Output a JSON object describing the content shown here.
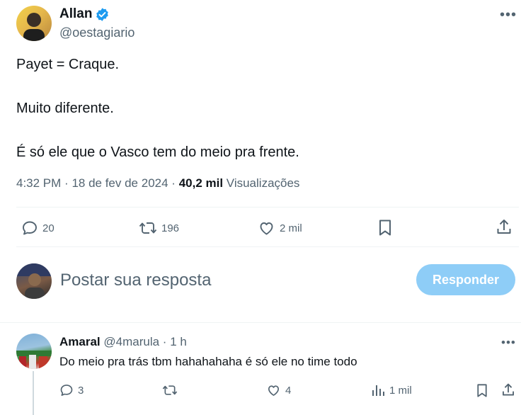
{
  "tweet": {
    "author_name": "Allan",
    "author_handle": "@oestagiario",
    "lines": [
      "Payet = Craque.",
      "Muito diferente.",
      "É só ele que o Vasco tem do meio pra frente."
    ],
    "time": "4:32 PM",
    "date": "18 de fev de 2024",
    "views_count": "40,2 mil",
    "views_label": "Visualizações",
    "replies": "20",
    "retweets": "196",
    "likes": "2 mil",
    "verified_color": "#1d9bf0"
  },
  "composer": {
    "placeholder": "Postar sua resposta",
    "button_label": "Responder"
  },
  "reply": {
    "author_name": "Amaral",
    "author_handle": "@4marula",
    "time": "1 h",
    "text": "Do meio pra trás tbm hahahahaha é só ele no time todo",
    "replies": "3",
    "retweets": "",
    "likes": "4",
    "views": "1 mil"
  }
}
